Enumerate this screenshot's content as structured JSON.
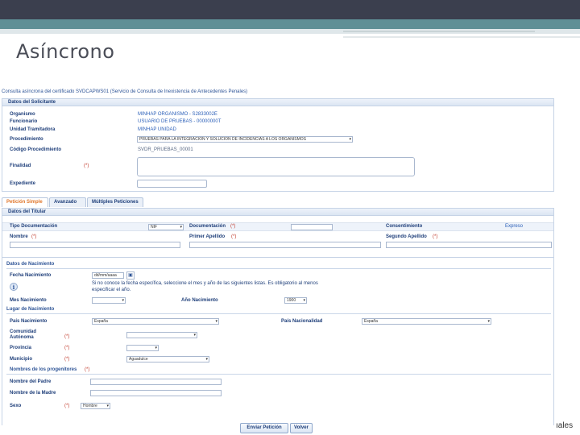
{
  "slide": {
    "title": "Asíncrono",
    "cutoff_text": "ıales"
  },
  "frame": {
    "title": "Consulta asíncrona del certificado SVDCAPWS01 (Servicio de Consulta de Inexistencia de Antecedentes Penales)"
  },
  "solicitante": {
    "heading": "Datos del Solicitante",
    "organismo_label": "Organismo",
    "organismo_value": "MINHAP ORGANISMO - S2833002E",
    "funcionario_label": "Funcionario",
    "funcionario_value": "USUARIO DE PRUEBAS - 00000000T",
    "unidad_label": "Unidad Tramitadora",
    "unidad_value": "MINHAP UNIDAD",
    "procedimiento_label": "Procedimiento",
    "procedimiento_value": "PRUEBAS PARA LA INTEGRACION Y SOLUCION DE INCIDENCIAS A LOS ORGANISMOS",
    "codigo_label": "Código Procedimiento",
    "codigo_value": "SVDR_PRUEBAS_00001",
    "finalidad_label": "Finalidad",
    "expediente_label": "Expediente",
    "required_mark": "(*)"
  },
  "tabs": [
    "Petición Simple",
    "Avanzado",
    "Múltiples Peticiones"
  ],
  "titular": {
    "heading": "Datos del Titular",
    "tipo_doc_label": "Tipo Documentación",
    "tipo_doc_value": "NIF",
    "documentacion_label": "Documentación",
    "consentimiento_label": "Consentimiento",
    "consentimiento_value": "Expreso",
    "nombre_label": "Nombre",
    "primer_apellido_label": "Primer Apellido",
    "segundo_apellido_label": "Segundo Apellido",
    "required_mark": "(*)"
  },
  "nacimiento": {
    "heading": "Datos de Nacimiento",
    "fecha_label": "Fecha Nacimiento",
    "fecha_placeholder": "dd/mm/aaaa",
    "fecha_hint": "Si no conoce la fecha específica, seleccione el mes y año de las siguientes listas. Es obligatorio al menos especificar el año.",
    "mes_label": "Mes Nacimiento",
    "ano_label": "Año Nacimiento",
    "ano_value": "1900",
    "lugar_heading": "Lugar de Nacimiento",
    "pais_label": "País Nacimiento",
    "pais_value": "España",
    "pais_nac_label": "País Nacionalidad",
    "pais_nac_value": "España",
    "comunidad_label": "Comunidad Autónoma",
    "provincia_label": "Provincia",
    "municipio_label": "Municipio",
    "municipio_value": "Aguadulce",
    "progenitores_heading": "Nombres de los progenitores",
    "padre_label": "Nombre del Padre",
    "madre_label": "Nombre de la Madre",
    "sexo_label": "Sexo",
    "sexo_value": "Hombre",
    "required_mark": "(*)"
  },
  "buttons": {
    "enviar": "Enviar Petición",
    "volver": "Volver"
  },
  "icons": {
    "dropdown": "▾",
    "calendar": "▣",
    "info": "i"
  }
}
